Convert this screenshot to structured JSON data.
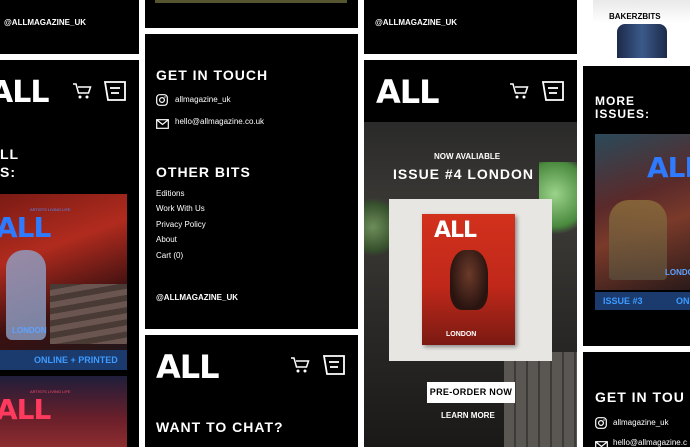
{
  "social_handle_upper": "@ALLMAGAZINE_UK",
  "social_handle": "allmagazine_uk",
  "email": "hello@allmagazine.co.uk",
  "logo_text": "ALL",
  "panel_left": {
    "more_issues_partial_1": "LL",
    "more_issues_partial_2": "S:",
    "cover_logo": "ALL",
    "cover_city": "LONDON",
    "cover_tagline": "ARTISTS LIVING LIFE",
    "bar_label": "ONLINE + PRINTED",
    "cover2_logo": "ALL",
    "cover2_tagline": "ARTISTS LIVING LIFE"
  },
  "panel_footer": {
    "get_in_touch": "GET IN TOUCH",
    "other_bits": "OTHER BITS",
    "links": [
      "Editions",
      "Work With Us",
      "Privacy Policy",
      "About",
      "Cart (0)"
    ]
  },
  "panel_chat": {
    "heading": "WANT TO CHAT?"
  },
  "panel_hero": {
    "now_available": "NOW AVALIABLE",
    "issue_title": "ISSUE #4 LONDON",
    "cover_logo": "ALL",
    "cover_city": "LONDON",
    "preorder_label": "PRE-ORDER NOW",
    "learn_more_label": "LEARN MORE"
  },
  "panel_right": {
    "bakerzbits": "BAKERZBITS",
    "more_issues_1": "MORE",
    "more_issues_2": "ISSUES:",
    "cover_logo": "ALL",
    "cover_city": "LONDO",
    "bar_issue": "ISSUE #3",
    "bar_online": "ON",
    "get_in_touch_partial": "GET IN TOU",
    "email_partial": "hello@allmagazine.c"
  }
}
